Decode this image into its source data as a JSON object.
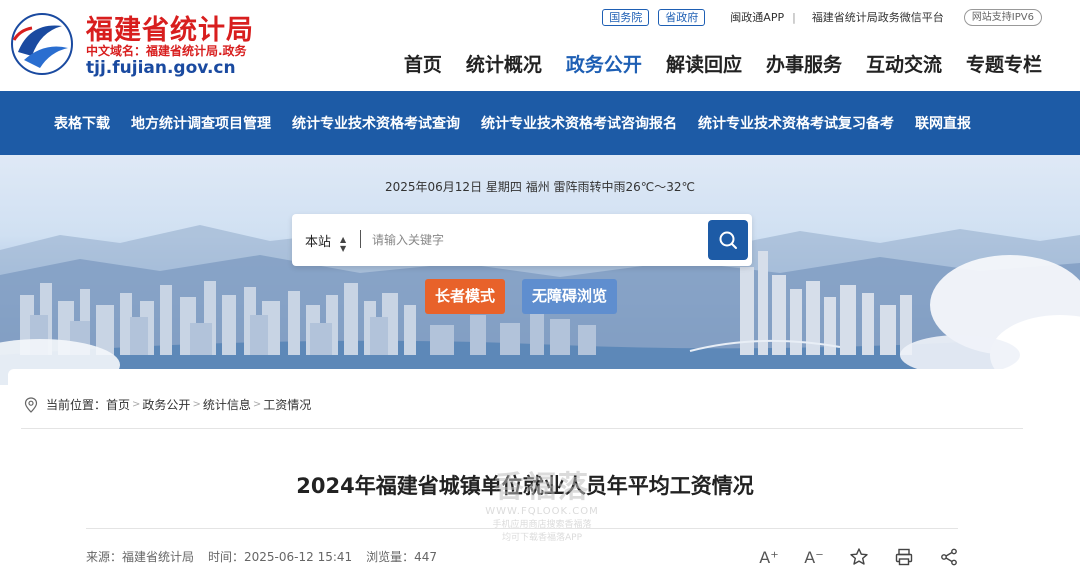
{
  "logo": {
    "title": "福建省统计局",
    "domain": "中文域名：福建省统计局.政务",
    "url": "tjj.fujian.gov.cn"
  },
  "top_links": {
    "state_council": "国务院",
    "provincial_gov": "省政府",
    "app": "闽政通APP",
    "wechat": "福建省统计局政务微信平台",
    "ipv6": "网站支持IPV6"
  },
  "main_nav": [
    {
      "label": "首页",
      "active": false
    },
    {
      "label": "统计概况",
      "active": false
    },
    {
      "label": "政务公开",
      "active": true
    },
    {
      "label": "解读回应",
      "active": false
    },
    {
      "label": "办事服务",
      "active": false
    },
    {
      "label": "互动交流",
      "active": false
    },
    {
      "label": "专题专栏",
      "active": false
    }
  ],
  "sub_nav": [
    "表格下载",
    "地方统计调查项目管理",
    "统计专业技术资格考试查询",
    "统计专业技术资格考试咨询报名",
    "统计专业技术资格考试复习备考",
    "联网直报"
  ],
  "banner": {
    "date_weather": "2025年06月12日  星期四  福州 雷阵雨转中雨26℃～32℃",
    "search_scope": "本站",
    "search_placeholder": "请输入关键字",
    "elder_mode": "长者模式",
    "accessible": "无障碍浏览"
  },
  "breadcrumb": {
    "prefix": "当前位置：",
    "items": [
      "首页",
      "政务公开",
      "统计信息",
      "工资情况"
    ]
  },
  "article": {
    "title": "2024年福建省城镇单位就业人员年平均工资情况",
    "source": "来源：福建省统计局",
    "time": "时间：2025-06-12 15:41",
    "views": "浏览量：447"
  },
  "tools": {
    "font_larger": "A⁺",
    "font_smaller": "A⁻"
  },
  "watermark": {
    "big": "香福落",
    "url": "WWW.FQLOOK.COM",
    "line1": "手机应用商店搜索香福落",
    "line2": "均可下载香福落APP"
  },
  "colors": {
    "brand_blue": "#1d5ba6",
    "logo_red": "#d81e1e",
    "elder_orange": "#e8622a",
    "accessible_blue": "#5f8ecf"
  }
}
